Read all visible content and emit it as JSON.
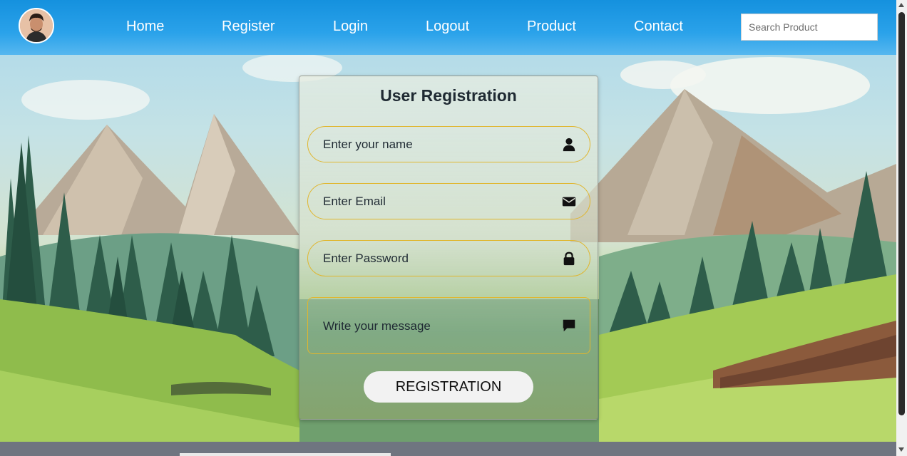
{
  "nav": {
    "links": [
      "Home",
      "Register",
      "Login",
      "Logout",
      "Product",
      "Contact"
    ],
    "search_placeholder": "Search Product"
  },
  "form": {
    "title": "User Registration",
    "name_placeholder": "Enter your name",
    "email_placeholder": "Enter Email",
    "password_placeholder": "Enter Password",
    "message_placeholder": "Write your message",
    "submit_label": "REGISTRATION"
  },
  "icons": {
    "name": "user-icon",
    "email": "envelope-icon",
    "password": "lock-icon",
    "message": "comment-icon"
  },
  "colors": {
    "navbar": "#1591de",
    "field_border": "#e0b62e",
    "text": "#1f2a33",
    "button_bg": "#f2f2f2"
  }
}
